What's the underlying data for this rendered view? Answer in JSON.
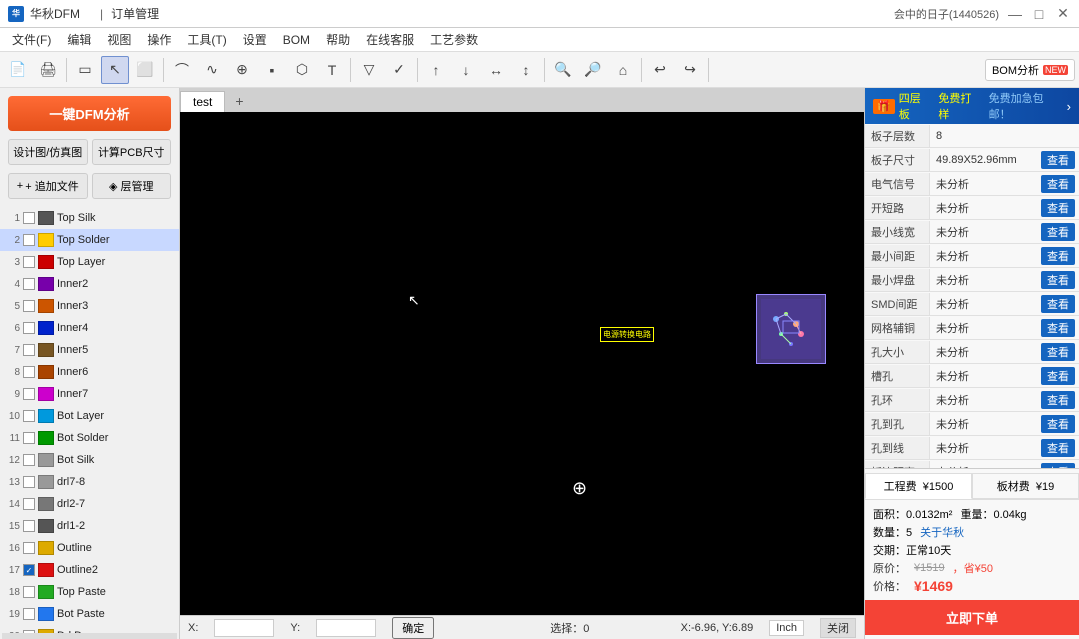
{
  "titlebar": {
    "logo": "华",
    "title": "华秋DFM",
    "tab": "订单管理",
    "user": "会中的日子(1440526)",
    "minimize": "—",
    "maximize": "□",
    "close": "✕"
  },
  "menubar": {
    "items": [
      "文件(F)",
      "编辑",
      "视图",
      "操作",
      "工具(T)",
      "设置",
      "BOM",
      "帮助",
      "在线客服",
      "工艺参数"
    ]
  },
  "toolbar": {
    "bom_label": "BOM分析",
    "bom_new": "NEW"
  },
  "left_panel": {
    "dfm_btn": "一键DFM分析",
    "design_sim": "设计图/仿真图",
    "calc_pcb": "计算PCB尺寸",
    "add_file": "+ 追加文件",
    "layer_mgr": "◈ 层管理",
    "layers": [
      {
        "num": "1",
        "checked": false,
        "color": "#ffffff",
        "name": "Top Silk"
      },
      {
        "num": "2",
        "checked": false,
        "color": "#ffff00",
        "name": "Top Solder",
        "active": true
      },
      {
        "num": "3",
        "checked": false,
        "color": "#ff0000",
        "name": "Top Layer"
      },
      {
        "num": "4",
        "checked": false,
        "color": "#9900cc",
        "name": "Inner2"
      },
      {
        "num": "5",
        "checked": false,
        "color": "#ff6600",
        "name": "Inner3"
      },
      {
        "num": "6",
        "checked": false,
        "color": "#0000ff",
        "name": "Inner4"
      },
      {
        "num": "7",
        "checked": false,
        "color": "#996633",
        "name": "Inner5"
      },
      {
        "num": "8",
        "checked": false,
        "color": "#cc6600",
        "name": "Inner6"
      },
      {
        "num": "9",
        "checked": false,
        "color": "#ff00ff",
        "name": "Inner7"
      },
      {
        "num": "10",
        "checked": false,
        "color": "#00bfff",
        "name": "Bot Layer"
      },
      {
        "num": "11",
        "checked": false,
        "color": "#00cc00",
        "name": "Bot Solder"
      },
      {
        "num": "12",
        "checked": false,
        "color": "#cccccc",
        "name": "Bot Silk"
      },
      {
        "num": "13",
        "checked": false,
        "color": "#aaaaaa",
        "name": "drl7-8"
      },
      {
        "num": "14",
        "checked": false,
        "color": "#888888",
        "name": "drl2-7"
      },
      {
        "num": "15",
        "checked": false,
        "color": "#666666",
        "name": "drl1-2"
      },
      {
        "num": "16",
        "checked": false,
        "color": "#ffcc00",
        "name": "Outline"
      },
      {
        "num": "17",
        "checked": true,
        "color": "#ff3333",
        "name": "Outline2"
      },
      {
        "num": "18",
        "checked": false,
        "color": "#33cc33",
        "name": "Top Paste"
      },
      {
        "num": "19",
        "checked": false,
        "color": "#3399ff",
        "name": "Bot Paste"
      },
      {
        "num": "20",
        "checked": false,
        "color": "#ffcc00",
        "name": "Drl Draw"
      }
    ]
  },
  "canvas": {
    "tab": "test",
    "add_tab": "+",
    "status_select": "选择：0",
    "coords": "X:-6.96, Y:6.89",
    "unit": "Inch",
    "off": "关闭"
  },
  "statusbar": {
    "xy_label": "Y:",
    "confirm": "确定"
  },
  "right_panel": {
    "banner_text": "四层板",
    "banner_free": "免费打样",
    "banner_sub": "免费加急包邮！",
    "rows": [
      {
        "label": "板子层数",
        "value": "8",
        "has_btn": false
      },
      {
        "label": "板子尺寸",
        "value": "49.89X52.96mm",
        "has_btn": true
      },
      {
        "label": "电气信号",
        "value": "未分析",
        "has_btn": true
      },
      {
        "label": "开短路",
        "value": "未分析",
        "has_btn": true
      },
      {
        "label": "最小线宽",
        "value": "未分析",
        "has_btn": true
      },
      {
        "label": "最小间距",
        "value": "未分析",
        "has_btn": true
      },
      {
        "label": "最小焊盘",
        "value": "未分析",
        "has_btn": true
      },
      {
        "label": "SMD间距",
        "value": "未分析",
        "has_btn": true
      },
      {
        "label": "网格辅铜",
        "value": "未分析",
        "has_btn": true
      },
      {
        "label": "孔大小",
        "value": "未分析",
        "has_btn": true
      },
      {
        "label": "槽孔",
        "value": "未分析",
        "has_btn": true
      },
      {
        "label": "孔环",
        "value": "未分析",
        "has_btn": true
      },
      {
        "label": "孔到孔",
        "value": "未分析",
        "has_btn": true
      },
      {
        "label": "孔到线",
        "value": "未分析",
        "has_btn": true
      },
      {
        "label": "板边距离",
        "value": "未分析",
        "has_btn": true
      }
    ],
    "pricing_tabs": [
      {
        "label": "工程费",
        "sub": "¥1500",
        "active": true
      },
      {
        "label": "板材费",
        "sub": "¥19",
        "active": false
      }
    ],
    "area": "面积：0.0132m²",
    "weight": "重量：0.04kg",
    "quantity": "数量：5",
    "huaqiu_link": "关于华秋",
    "delivery": "交期：正常10天",
    "original_price": "¥1519",
    "discount": "，省¥50",
    "final_label": "价格：",
    "final_price": "¥1469",
    "order_btn": "立即下单"
  }
}
